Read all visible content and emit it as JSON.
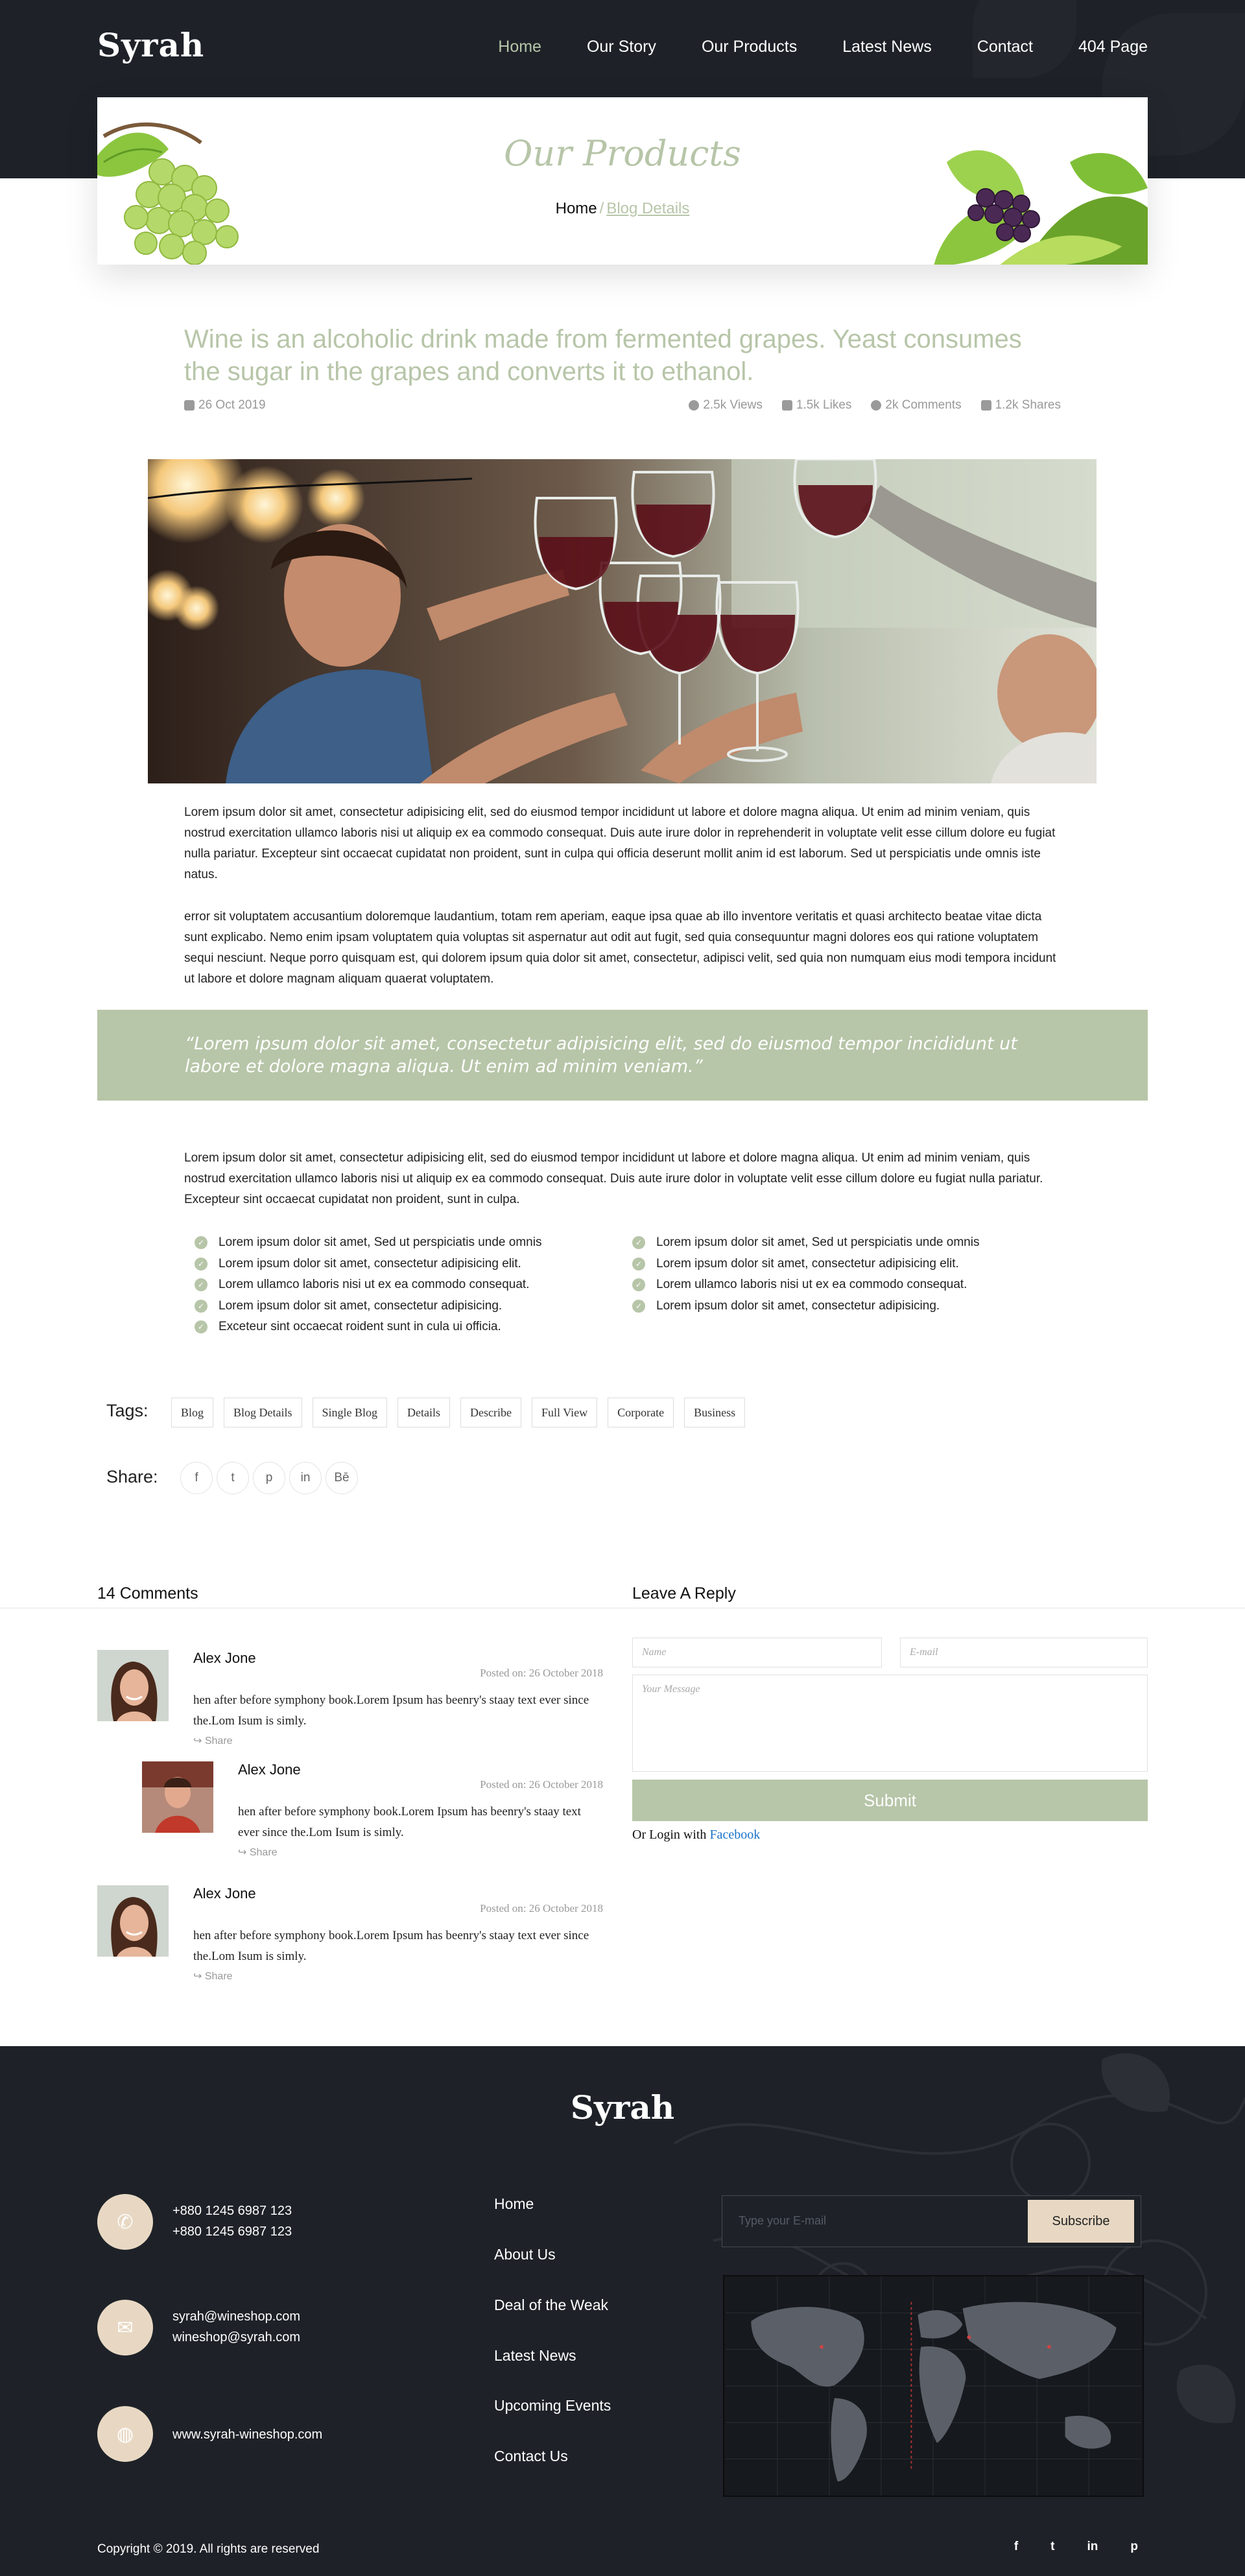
{
  "header": {
    "logo": "Syrah",
    "nav": [
      "Home",
      "Our Story",
      "Our Products",
      "Latest News",
      "Contact",
      "404 Page"
    ],
    "active_nav": "Home"
  },
  "banner": {
    "title": "Our Products",
    "crumb_home": "Home",
    "crumb_sep": "/",
    "crumb_current": "Blog Details"
  },
  "article": {
    "headline": "Wine is an alcoholic drink made from fermented grapes. Yeast consumes the sugar in the grapes and converts it to ethanol.",
    "date": "26 Oct 2019",
    "views": "2.5k Views",
    "likes": "1.5k Likes",
    "comments": "2k Comments",
    "shares": "1.2k Shares",
    "para1": "Lorem ipsum dolor sit amet, consectetur adipisicing elit, sed do eiusmod tempor incididunt ut labore et dolore magna aliqua. Ut enim ad minim veniam, quis nostrud exercitation ullamco laboris nisi ut aliquip ex ea commodo consequat. Duis aute irure dolor in reprehenderit in voluptate velit esse cillum dolore eu fugiat nulla pariatur. Excepteur sint occaecat cupidatat non proident, sunt in culpa qui officia deserunt mollit anim id est laborum. Sed ut perspiciatis unde omnis iste natus.",
    "para2": "error sit voluptatem accusantium doloremque laudantium, totam rem aperiam, eaque ipsa quae ab illo inventore veritatis et quasi architecto beatae vitae dicta sunt explicabo. Nemo enim ipsam voluptatem quia voluptas sit aspernatur aut odit aut fugit, sed quia consequuntur magni dolores eos qui ratione voluptatem sequi nesciunt. Neque porro quisquam est, qui dolorem ipsum quia dolor sit amet, consectetur, adipisci velit, sed quia non numquam eius modi tempora incidunt ut labore et dolore magnam aliquam quaerat voluptatem.",
    "quote": "“Lorem ipsum dolor sit amet, consectetur adipisicing elit, sed do eiusmod tempor incididunt ut labore et dolore magna aliqua. Ut enim ad minim veniam.”",
    "para3": "Lorem ipsum dolor sit amet, consectetur adipisicing elit, sed do eiusmod tempor incididunt ut labore et dolore magna aliqua. Ut enim ad minim veniam, quis nostrud exercitation ullamco laboris nisi ut aliquip ex ea commodo consequat. Duis aute irure dolor in voluptate velit esse cillum dolore eu fugiat nulla pariatur. Excepteur sint occaecat cupidatat non proident, sunt in culpa.",
    "list_left": [
      "Lorem ipsum dolor sit amet, Sed ut perspiciatis unde omnis",
      "Lorem ipsum dolor sit amet, consectetur adipisicing elit.",
      "Lorem ullamco laboris nisi ut ex ea commodo consequat.",
      "Lorem ipsum dolor sit amet, consectetur adipisicing.",
      "Exceteur sint occaecat roident sunt in cula ui officia."
    ],
    "list_right": [
      "Lorem ipsum dolor sit amet, Sed ut perspiciatis unde omnis",
      "Lorem ipsum dolor sit amet, consectetur adipisicing elit.",
      "Lorem ullamco laboris nisi ut ex ea commodo consequat.",
      "Lorem ipsum dolor sit amet, consectetur adipisicing."
    ]
  },
  "tags": {
    "label": "Tags:",
    "items": [
      "Blog",
      "Blog Details",
      "Single Blog",
      "Details",
      "Describe",
      "Full View",
      "Corporate",
      "Business"
    ]
  },
  "share": {
    "label": "Share:",
    "icons": [
      "facebook-icon",
      "twitter-icon",
      "pinterest-icon",
      "linkedin-icon",
      "behance-icon"
    ],
    "glyphs": [
      "f",
      "t",
      "p",
      "in",
      "Bē"
    ]
  },
  "comments": {
    "title": "14 Comments",
    "items": [
      {
        "name": "Alex Jone",
        "date": "Posted on: 26 October 2018",
        "text": "hen after before symphony book.Lorem Ipsum has beenry's staay text ever since the.Lom Isum is simly.",
        "share": "Share"
      },
      {
        "name": "Alex Jone",
        "date": "Posted on: 26 October 2018",
        "text": "hen after before symphony book.Lorem Ipsum has beenry's staay text ever since the.Lom Isum is simly.",
        "share": "Share"
      },
      {
        "name": "Alex Jone",
        "date": "Posted on: 26 October 2018",
        "text": "hen after before symphony book.Lorem Ipsum has beenry's staay text ever since the.Lom Isum is simly.",
        "share": "Share"
      }
    ]
  },
  "reply": {
    "title": "Leave A Reply",
    "name_placeholder": "Name",
    "email_placeholder": "E-mail",
    "message_placeholder": "Your Message",
    "submit": "Submit",
    "or_login": "Or Login with",
    "facebook": "Facebook"
  },
  "footer": {
    "logo": "Syrah",
    "phone1": "+880 1245 6987 123",
    "phone2": "+880 1245 6987 123",
    "email1": "syrah@wineshop.com",
    "email2": "wineshop@syrah.com",
    "website": "www.syrah-wineshop.com",
    "links": [
      "Home",
      "About Us",
      "Deal of the Weak",
      "Latest News",
      "Upcoming Events",
      "Contact Us"
    ],
    "subscribe_placeholder": "Type your E-mail",
    "subscribe_button": "Subscribe",
    "copyright": "Copyright © 2019. All rights are reserved",
    "social": [
      "facebook-icon",
      "twitter-icon",
      "linkedin-icon",
      "pinterest-icon"
    ],
    "social_glyphs": [
      "f",
      "t",
      "in",
      "p"
    ]
  },
  "colors": {
    "accent": "#b7c5a8",
    "dark": "#1e2228",
    "beige": "#e8d8c3"
  }
}
